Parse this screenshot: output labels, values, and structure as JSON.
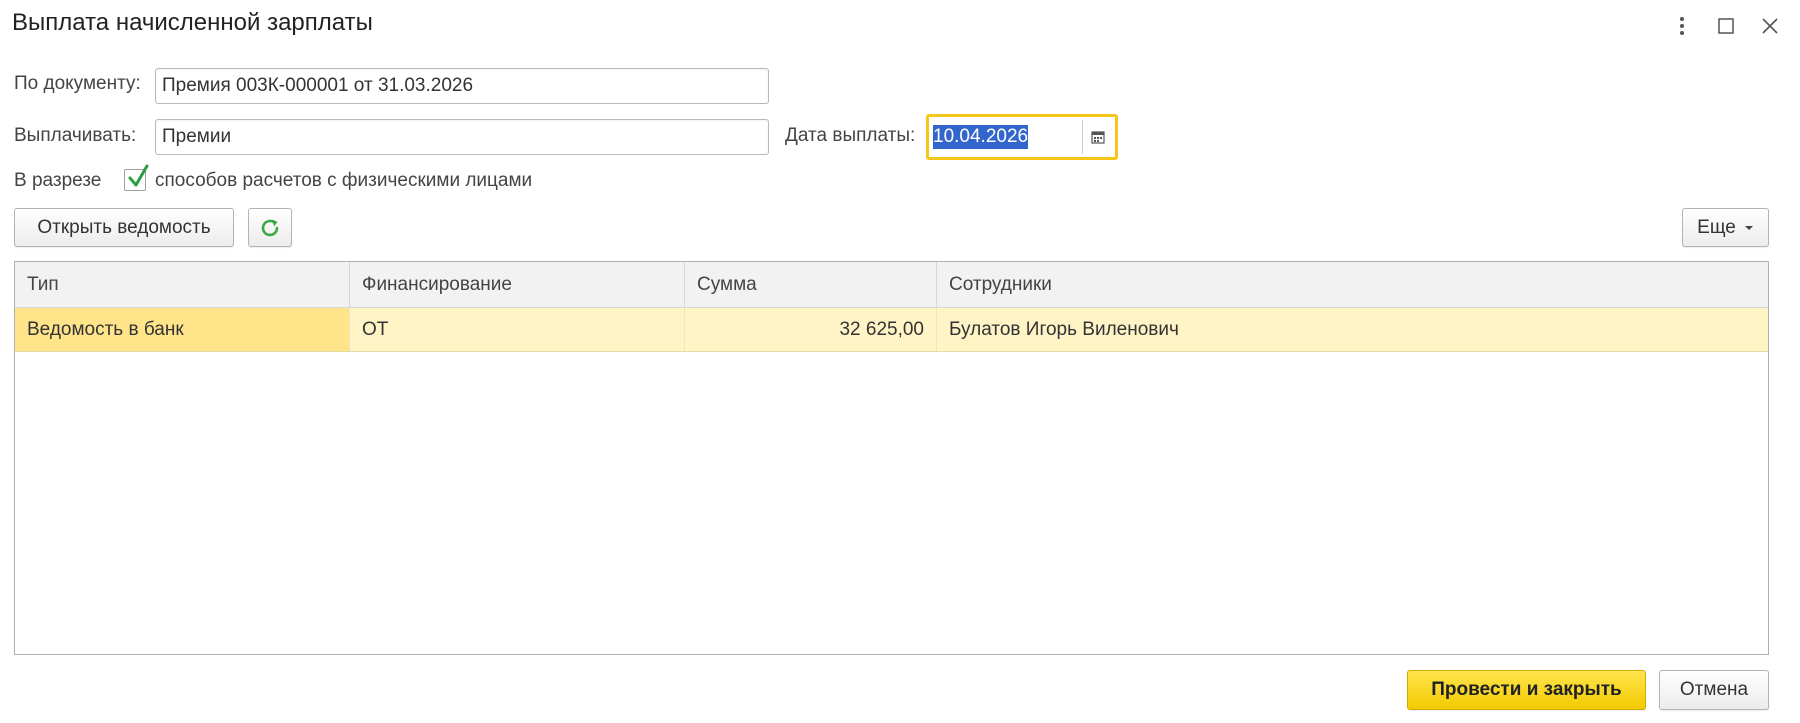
{
  "window": {
    "title": "Выплата начисленной зарплаты"
  },
  "form": {
    "document_label": "По документу:",
    "document_value": "Премия 003К-000001 от 31.03.2026",
    "pay_label": "Выплачивать:",
    "pay_value": "Премии",
    "date_label": "Дата выплаты:",
    "date_value": "10.04.2026",
    "breakdown_label": "В разрезе",
    "breakdown_checkbox_label": "способов расчетов с физическими лицами",
    "breakdown_checked": true
  },
  "toolbar": {
    "open_statement_label": "Открыть ведомость",
    "more_label": "Еще"
  },
  "table": {
    "columns": [
      "Тип",
      "Финансирование",
      "Сумма",
      "Сотрудники"
    ],
    "rows": [
      {
        "type": "Ведомость в банк",
        "financing": "ОТ",
        "amount": "32 625,00",
        "employees": "Булатов Игорь Виленович"
      }
    ]
  },
  "footer": {
    "post_close_label": "Провести и закрыть",
    "cancel_label": "Отмена"
  },
  "colors": {
    "primary_button": "#f5d000",
    "focus_border": "#f5c518",
    "selected_row": "#fff4c6",
    "active_cell": "#ffe48a",
    "check_green": "#2e9e3e",
    "refresh_green": "#3aa845",
    "selection_blue": "#3366cc"
  },
  "icons": {
    "menu": "more-vertical-icon",
    "maximize": "maximize-icon",
    "close": "close-icon",
    "calendar": "calendar-icon",
    "refresh": "refresh-icon",
    "dropdown": "chevron-down-icon",
    "check": "checkmark-icon"
  }
}
